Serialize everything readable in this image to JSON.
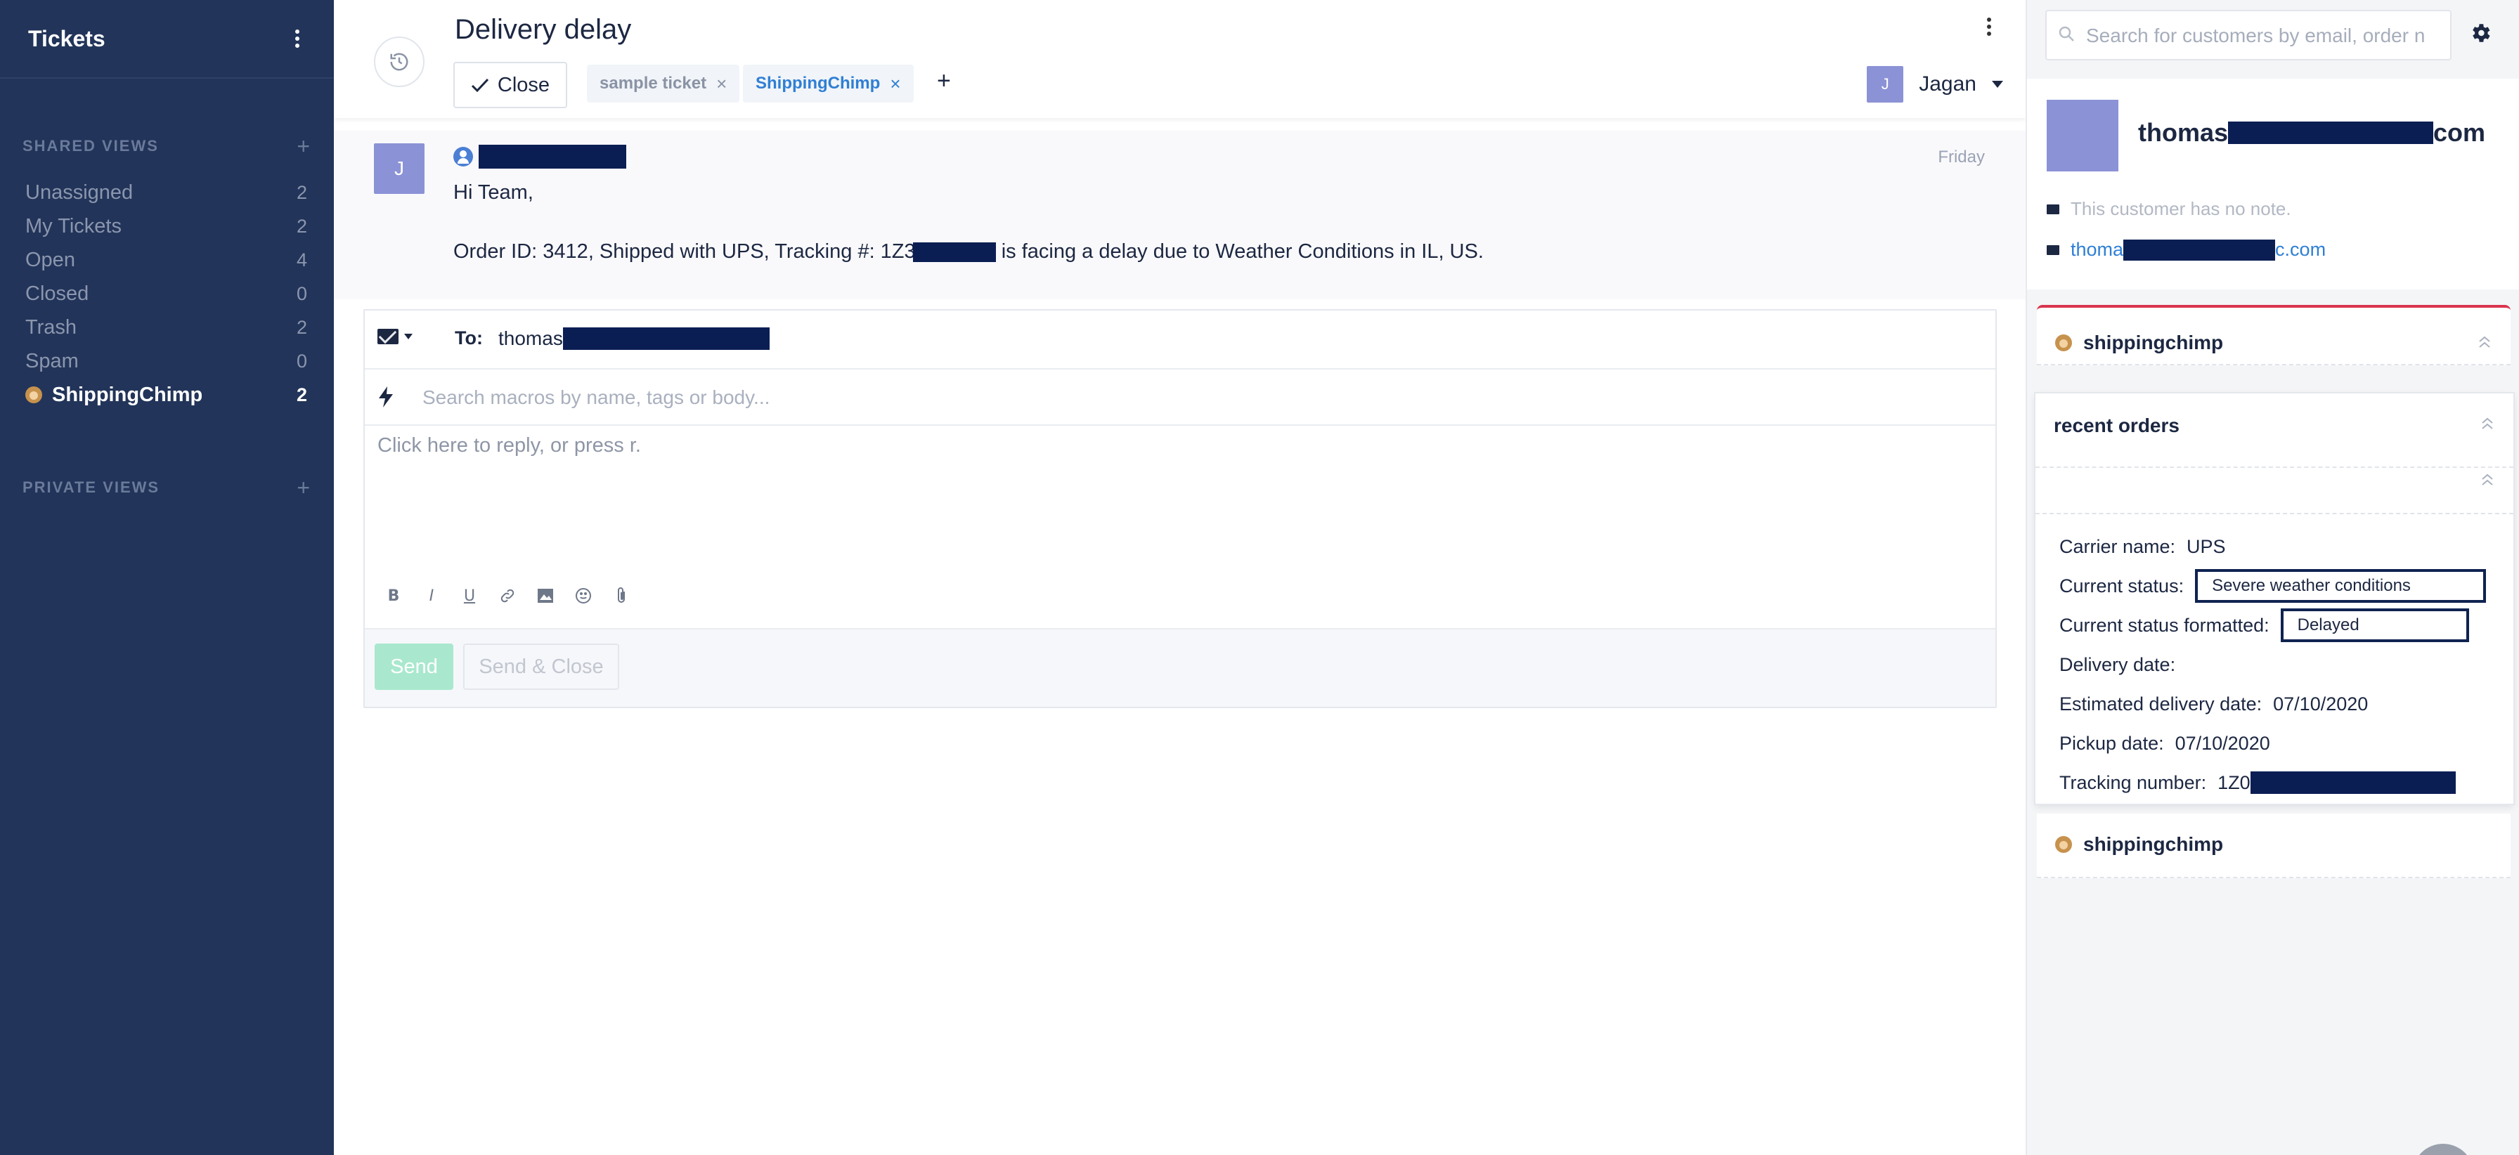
{
  "sidebar": {
    "title": "Tickets",
    "shared_views_label": "SHARED VIEWS",
    "private_views_label": "PRIVATE VIEWS",
    "add_symbol": "+",
    "items": [
      {
        "label": "Unassigned",
        "count": "2"
      },
      {
        "label": "My Tickets",
        "count": "2"
      },
      {
        "label": "Open",
        "count": "4"
      },
      {
        "label": "Closed",
        "count": "0"
      },
      {
        "label": "Trash",
        "count": "2"
      },
      {
        "label": "Spam",
        "count": "0"
      },
      {
        "label": "ShippingChimp",
        "count": "2",
        "icon": "monkey-icon",
        "active": true
      }
    ]
  },
  "ticket": {
    "title": "Delivery delay",
    "close_label": "Close",
    "tags": [
      {
        "label": "sample ticket",
        "remove": "×"
      },
      {
        "label": "ShippingChimp",
        "remove": "×"
      }
    ],
    "add_tag": "+",
    "assignee": {
      "initial": "J",
      "name": "Jagan"
    }
  },
  "message": {
    "avatar_initial": "J",
    "date": "Friday",
    "greeting": "Hi Team,",
    "body_before": "Order ID: 3412, Shipped with UPS, Tracking #: 1Z3",
    "body_after": " is facing a delay due to Weather Conditions in IL, US."
  },
  "reply": {
    "to_label": "To:",
    "to_value": "thomas",
    "macro_placeholder": "Search macros by name, tags or body...",
    "reply_placeholder": "Click here to reply, or press r.",
    "send_label": "Send",
    "send_close_label": "Send & Close",
    "toolbar": [
      "bold-icon",
      "italic-icon",
      "underline-icon",
      "link-icon",
      "image-icon",
      "emoji-icon",
      "attachment-icon"
    ]
  },
  "right_panel": {
    "search_placeholder": "Search for customers by email, order n",
    "customer": {
      "name_prefix": "thomas",
      "name_suffix": "com",
      "note": "This customer has no note.",
      "email_prefix": "thoma",
      "email_suffix": "c.com"
    },
    "widget_1_title": "shippingchimp",
    "orders_title": "recent orders",
    "fields": {
      "carrier_label": "Carrier name:",
      "carrier_value": "UPS",
      "status_label": "Current status:",
      "status_value": "Severe weather conditions",
      "status_formatted_label": "Current status formatted:",
      "status_formatted_value": "Delayed",
      "delivery_date_label": "Delivery date:",
      "estimated_label": "Estimated delivery date:",
      "estimated_value": "07/10/2020",
      "pickup_label": "Pickup date:",
      "pickup_value": "07/10/2020",
      "tracking_label": "Tracking number:",
      "tracking_value": "1Z0"
    },
    "widget_2_title": "shippingchimp"
  },
  "colors": {
    "sidebar_bg": "#223459",
    "accent_blue": "#2f7fd4",
    "avatar": "#8b92d6",
    "send_disabled": "#a9e8ce",
    "redaction": "#0b1e54",
    "widget_accent": "#d9344e"
  }
}
